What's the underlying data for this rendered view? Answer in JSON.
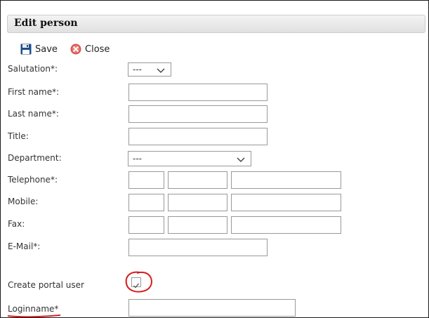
{
  "header": {
    "title": "Edit person"
  },
  "toolbar": {
    "save_label": "Save",
    "close_label": "Close"
  },
  "form": {
    "salutation": {
      "label": "Salutation*:",
      "value": "---"
    },
    "first_name": {
      "label": "First name*:",
      "value": ""
    },
    "last_name": {
      "label": "Last name*:",
      "value": ""
    },
    "title": {
      "label": "Title:",
      "value": ""
    },
    "department": {
      "label": "Department:",
      "value": "---"
    },
    "telephone": {
      "label": "Telephone*:"
    },
    "mobile": {
      "label": "Mobile:"
    },
    "fax": {
      "label": "Fax:"
    },
    "email": {
      "label": "E-Mail*:",
      "value": ""
    },
    "create_portal_user": {
      "label": "Create portal user",
      "checked": true
    },
    "loginname": {
      "label": "Loginname*",
      "value": ""
    }
  },
  "colors": {
    "annotation": "#d42020",
    "save_icon": "#1e4f8a",
    "close_icon": "#d9534f"
  },
  "icons": {
    "save": "floppy-disk-icon",
    "close": "close-circle-icon",
    "dropdown": "chevron-down-icon",
    "check": "checkmark-icon"
  }
}
